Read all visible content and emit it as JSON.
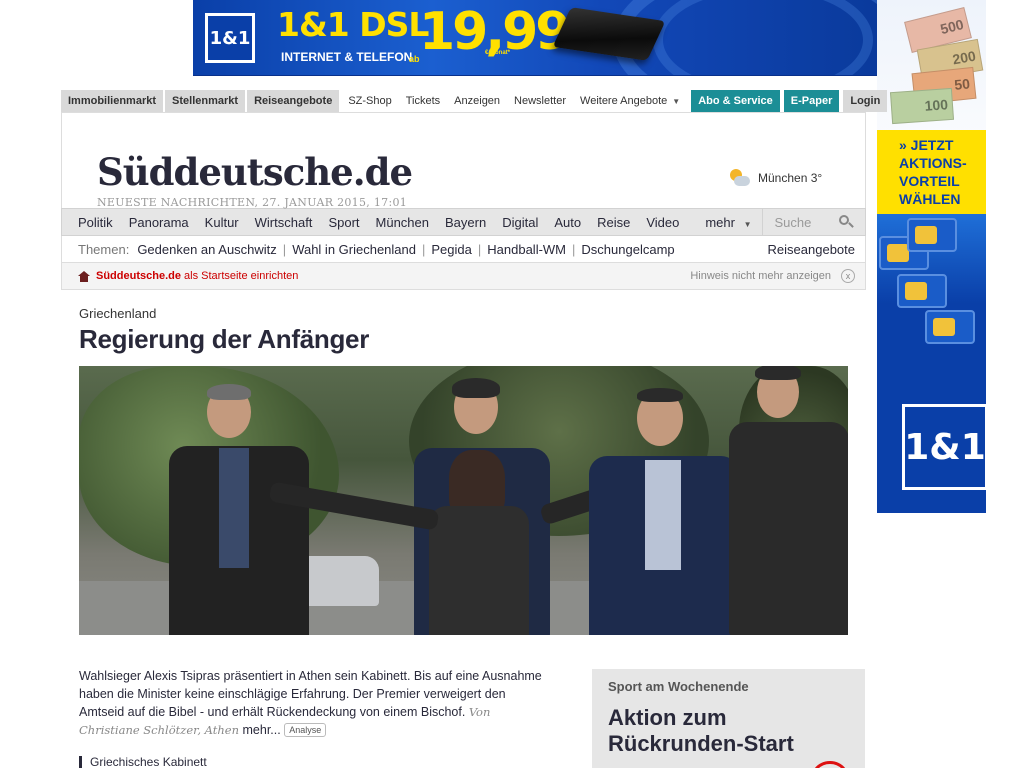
{
  "ad_top": {
    "logo": "1&1",
    "headline": "1&1 DSL",
    "subline": "INTERNET & TELEFON",
    "ab": "ab",
    "price": "19,99",
    "per_month": "€/Monat*"
  },
  "ad_right": {
    "bill_values": [
      "500",
      "200",
      "50",
      "100"
    ],
    "cta_lines": [
      "» JETZT",
      "AKTIONS-",
      "VORTEIL",
      "WÄHLEN"
    ],
    "logo": "1&1"
  },
  "toplinks": {
    "grey": [
      "Immobilienmarkt",
      "Stellenmarkt",
      "Reiseangebote"
    ],
    "plain": [
      "SZ-Shop",
      "Tickets",
      "Anzeigen",
      "Newsletter",
      "Weitere Angebote"
    ],
    "abo": "Abo & Service",
    "epaper": "E-Paper",
    "login": "Login"
  },
  "header": {
    "logo": "Süddeutsche.de",
    "dateline": "NEUESTE NACHRICHTEN, 27. JANUAR 2015, 17:01",
    "weather": "München 3°"
  },
  "nav": {
    "items": [
      "Politik",
      "Panorama",
      "Kultur",
      "Wirtschaft",
      "Sport",
      "München",
      "Bayern",
      "Digital",
      "Auto",
      "Reise",
      "Video"
    ],
    "more": "mehr",
    "search_placeholder": "Suche"
  },
  "themes": {
    "label": "Themen:",
    "items": [
      "Gedenken an Auschwitz",
      "Wahl in Griechenland",
      "Pegida",
      "Handball-WM",
      "Dschungelcamp"
    ],
    "right": "Reiseangebote"
  },
  "hint": {
    "site": "Süddeutsche.de",
    "text": " als Startseite einrichten",
    "hide": "Hinweis nicht mehr anzeigen",
    "close": "x"
  },
  "article": {
    "kicker": "Griechenland",
    "headline": "Regierung der Anfänger",
    "lead": "Wahlsieger Alexis Tsipras präsentiert in Athen sein Kabinett. Bis auf eine Ausnahme haben die Minister keine einschlägige Erfahrung. Der Premier verweigert den Amtseid auf die Bibel - und erhält Rückendeckung von einem Bischof.",
    "author": "Von Christiane Schlötzer, Athen",
    "more": "mehr...",
    "badge": "Analyse",
    "related": "Griechisches Kabinett"
  },
  "sidebox": {
    "label": "Sport am Wochenende",
    "title_line1": "Aktion zum",
    "title_line2": "Rückrunden-Start"
  }
}
